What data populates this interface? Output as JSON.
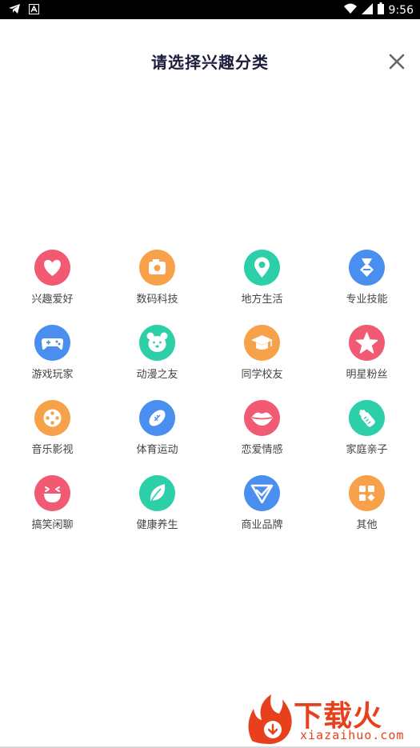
{
  "status_bar": {
    "time": "9:56",
    "icons": [
      "telegram-icon",
      "notification-a-icon",
      "wifi-icon",
      "signal-icon",
      "battery-icon"
    ]
  },
  "header": {
    "title": "请选择兴趣分类",
    "close_icon": "close-icon"
  },
  "categories": [
    {
      "label": "兴趣爱好",
      "icon": "heart-icon",
      "color": "#f25a73"
    },
    {
      "label": "数码科技",
      "icon": "camera-icon",
      "color": "#f7a24a"
    },
    {
      "label": "地方生活",
      "icon": "location-pin-icon",
      "color": "#2ccfa7"
    },
    {
      "label": "专业技能",
      "icon": "medal-icon",
      "color": "#4a8ff0"
    },
    {
      "label": "游戏玩家",
      "icon": "gamepad-icon",
      "color": "#4a8ff0"
    },
    {
      "label": "动漫之友",
      "icon": "bear-face-icon",
      "color": "#2ccfa7"
    },
    {
      "label": "同学校友",
      "icon": "graduation-cap-icon",
      "color": "#f7a24a"
    },
    {
      "label": "明星粉丝",
      "icon": "star-icon",
      "color": "#f25a73"
    },
    {
      "label": "音乐影视",
      "icon": "film-reel-icon",
      "color": "#f7a24a"
    },
    {
      "label": "体育运动",
      "icon": "football-icon",
      "color": "#4a8ff0"
    },
    {
      "label": "恋爱情感",
      "icon": "lips-icon",
      "color": "#f25a73"
    },
    {
      "label": "家庭亲子",
      "icon": "baby-bottle-icon",
      "color": "#2ccfa7"
    },
    {
      "label": "搞笑闲聊",
      "icon": "laughing-face-icon",
      "color": "#f25a73"
    },
    {
      "label": "健康养生",
      "icon": "leaf-icon",
      "color": "#2ccfa7"
    },
    {
      "label": "商业品牌",
      "icon": "check-badge-icon",
      "color": "#4a8ff0"
    },
    {
      "label": "其他",
      "icon": "apps-grid-icon",
      "color": "#f7a24a"
    }
  ],
  "watermark": {
    "brand": "下载火",
    "url": "xiazaihuo.com"
  }
}
